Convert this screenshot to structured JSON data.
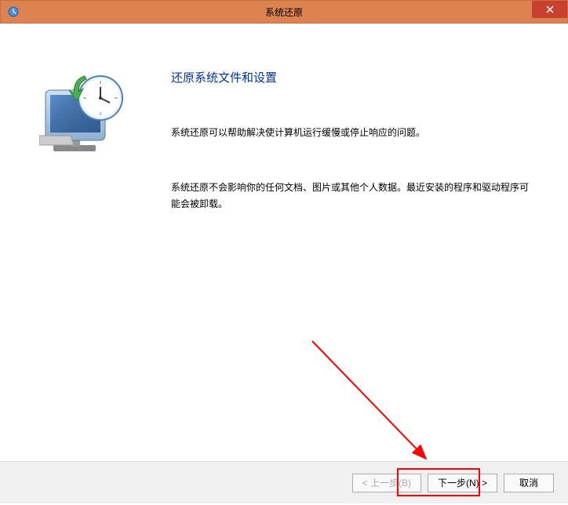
{
  "titlebar": {
    "title": "系统还原"
  },
  "main": {
    "heading": "还原系统文件和设置",
    "paragraph1": "系统还原可以帮助解决使计算机运行缓慢或停止响应的问题。",
    "paragraph2": "系统还原不会影响你的任何文档、图片或其他个人数据。最近安装的程序和驱动程序可能会被卸载。"
  },
  "footer": {
    "back_label": "< 上一步(B)",
    "next_label": "下一步(N) >",
    "cancel_label": "取消"
  }
}
